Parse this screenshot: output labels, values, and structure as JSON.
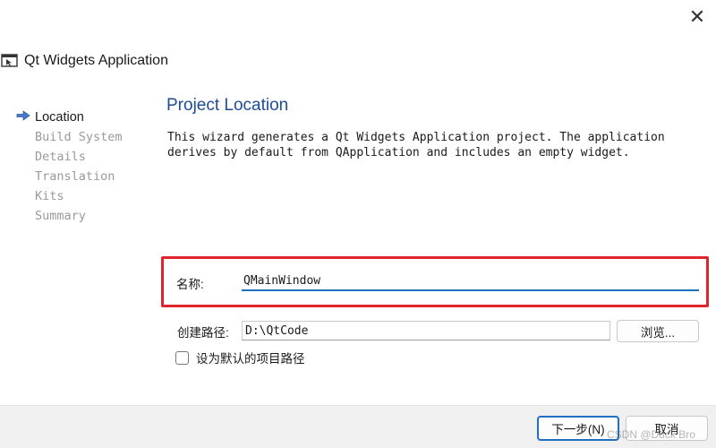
{
  "window": {
    "close_icon": "close-icon",
    "close_glyph": "✕"
  },
  "header": {
    "app_icon": "window-app-icon",
    "title": "Qt Widgets Application"
  },
  "steps": {
    "current_marker_icon": "arrow-right-icon",
    "items": [
      {
        "label": "Location",
        "current": true
      },
      {
        "label": "Build System",
        "current": false
      },
      {
        "label": "Details",
        "current": false
      },
      {
        "label": "Translation",
        "current": false
      },
      {
        "label": "Kits",
        "current": false
      },
      {
        "label": "Summary",
        "current": false
      }
    ]
  },
  "page": {
    "title": "Project Location",
    "description": "This wizard generates a Qt Widgets Application project. The application derives by default from QApplication and includes an empty widget."
  },
  "form": {
    "name_label": "名称:",
    "name_value": "QMainWindow",
    "path_label": "创建路径:",
    "path_value": "D:\\QtCode",
    "browse_label": "浏览...",
    "default_path_label": "设为默认的项目路径",
    "default_path_checked": false
  },
  "footer": {
    "next_label": "下一步(N)",
    "cancel_label": "取消"
  },
  "watermark": "CSDN @Duck Bro",
  "colors": {
    "accent": "#1f6fc2",
    "title_blue": "#1f4c97",
    "highlight_red": "#e0242e"
  }
}
